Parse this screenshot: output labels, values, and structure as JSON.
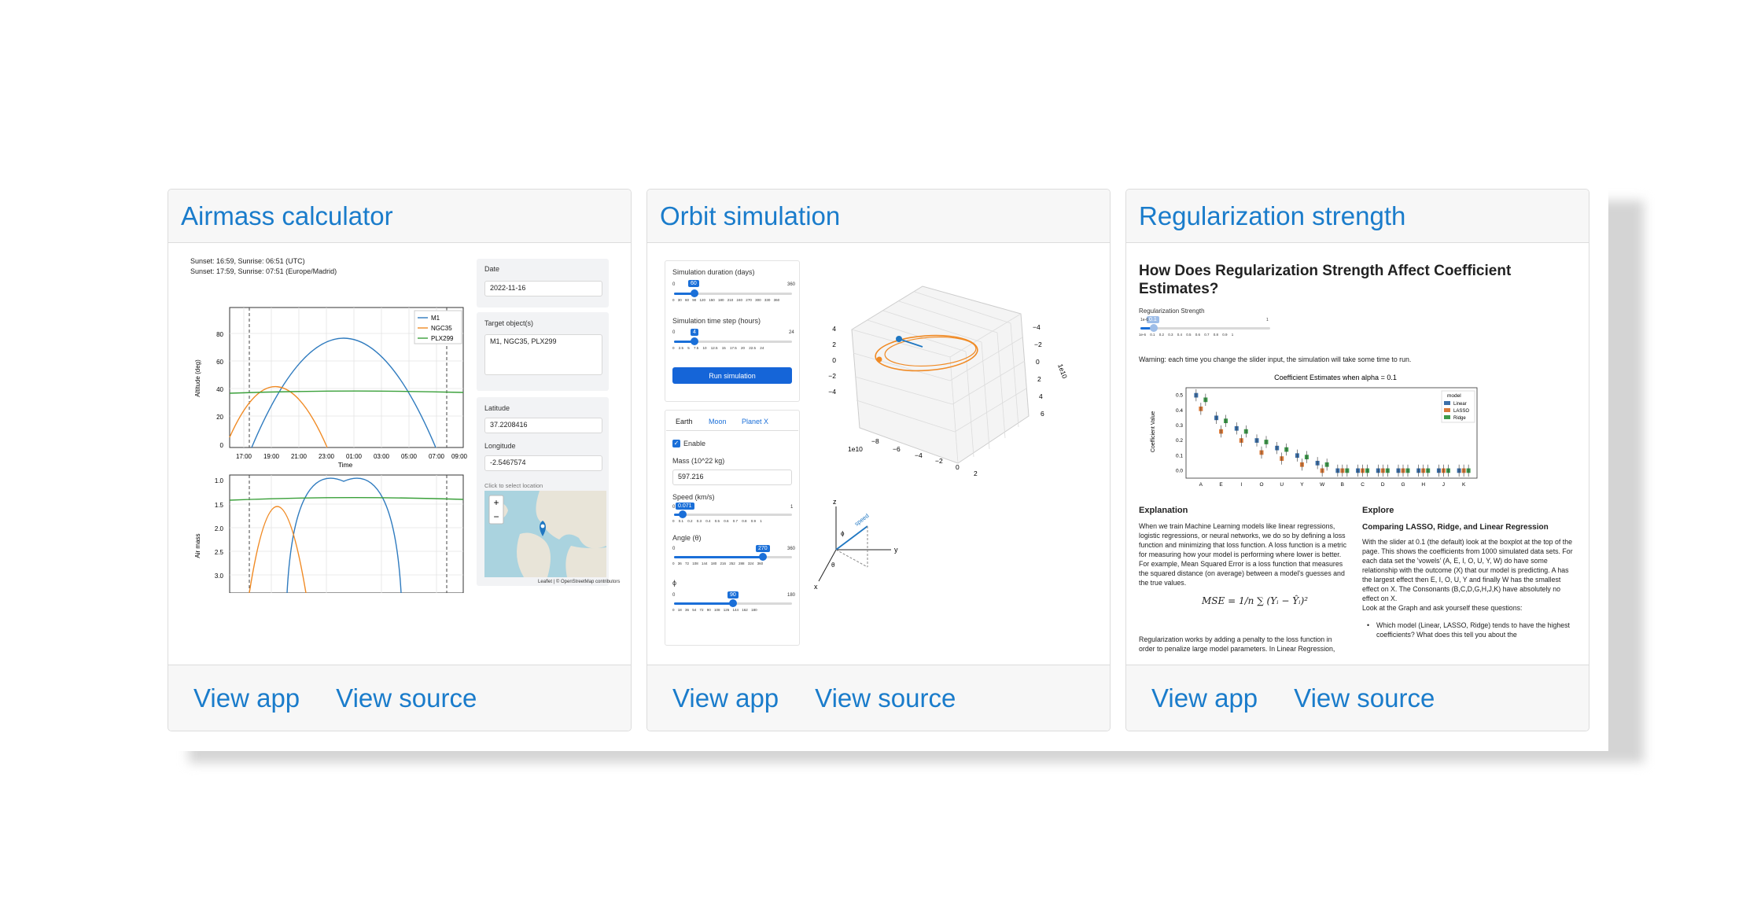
{
  "cards": [
    {
      "title": "Airmass calculator",
      "view_app": "View app",
      "view_source": "View source",
      "sun_line1": "Sunset: 16:59, Sunrise: 06:51 (UTC)",
      "sun_line2": "Sunset: 17:59, Sunrise: 07:51 (Europe/Madrid)",
      "date_label": "Date",
      "date_value": "2022-11-16",
      "target_label": "Target object(s)",
      "target_value": "M1, NGC35, PLX299",
      "lat_label": "Latitude",
      "lat_value": "37.2208416",
      "lon_label": "Longitude",
      "lon_value": "-2.5467574",
      "map_hint": "Click to select location",
      "map_attrib": "Leaflet | © OpenStreetMap contributors",
      "chart_top": {
        "ylabel": "Altitude (deg)",
        "xlabel": "Time",
        "yticks": [
          "0",
          "20",
          "40",
          "60",
          "80"
        ],
        "xticks": [
          "17:00",
          "19:00",
          "21:00",
          "23:00",
          "01:00",
          "03:00",
          "05:00",
          "07:00",
          "09:00"
        ],
        "legend": [
          "M1",
          "NGC35",
          "PLX299"
        ]
      },
      "chart_bottom": {
        "ylabel": "Air mass",
        "yticks": [
          "1.0",
          "1.5",
          "2.0",
          "2.5",
          "3.0"
        ]
      }
    },
    {
      "title": "Orbit simulation",
      "view_app": "View app",
      "view_source": "View source",
      "duration_label": "Simulation duration (days)",
      "duration_value": "60",
      "duration_min": "0",
      "duration_max": "360",
      "duration_ticks": "0 30 60 90 120 150 180 210 240 270 300 330 360",
      "timestep_label": "Simulation time step (hours)",
      "timestep_value": "4",
      "timestep_min": "0",
      "timestep_max": "24",
      "timestep_ticks": "0 2.5 5 7.5 10 12.5 15 17.5 20 22.5 24",
      "run_button": "Run simulation",
      "tabs": [
        "Earth",
        "Moon",
        "Planet X"
      ],
      "enable_label": "Enable",
      "mass_label": "Mass (10^22 kg)",
      "mass_value": "597.216",
      "speed_label": "Speed (km/s)",
      "speed_value": "0.071",
      "speed_min": "0",
      "speed_max": "1",
      "speed_ticks": "0 0.1 0.2 0.3 0.4 0.5 0.6 0.7 0.8 0.9 1",
      "angle_label": "Angle (θ)",
      "angle_value": "270",
      "angle_min": "0",
      "angle_max": "360",
      "angle_ticks": "0 36 72 108 144 180 216 252 288 324 360",
      "phi_label": "ϕ",
      "phi_value": "90",
      "phi_min": "0",
      "phi_max": "180",
      "phi_ticks": "0 18 36 54 72 90 108 126 144 162 180",
      "plot3d": {
        "zticks": [
          "4",
          "2",
          "0",
          "−2",
          "−4"
        ],
        "xticks": [
          "−8",
          "−6",
          "−4",
          "−2",
          "0",
          "2"
        ],
        "yticks": [
          "−4",
          "−2",
          "0",
          "2",
          "4",
          "6"
        ],
        "xexp": "1e10",
        "yexp": "1e10"
      },
      "axes_diagram": {
        "z": "z",
        "y": "y",
        "x": "x",
        "speed": "speed",
        "phi": "ϕ",
        "theta": "θ"
      }
    },
    {
      "title": "Regularization strength",
      "view_app": "View app",
      "view_source": "View source",
      "heading": "How Does Regularization Strength Affect Coefficient Estimates?",
      "slider_label": "Regularization Strength",
      "slider_value": "0.1",
      "slider_min": "1e-6",
      "slider_max": "1",
      "slider_ticks": "1e-6 0.1 0.2 0.3 0.4 0.5 0.6 0.7 0.8 0.9 1",
      "warning": "Warning: each time you change the slider input, the simulation will take some time to run.",
      "chart_title": "Coefficient Estimates when alpha = 0.1",
      "chart_ylabel": "Coefficient Value",
      "legend_title": "model",
      "legend": [
        "Linear",
        "LASSO",
        "Ridge"
      ],
      "explanation_title": "Explanation",
      "explanation_text": "When we train Machine Learning models like linear regressions, logistic regressions, or neural networks, we do so by defining a loss function and minimizing that loss function. A loss function is a metric for measuring how your model is performing where lower is better. For example, Mean Squared Error is a loss function that measures the squared distance (on average) between a model's guesses and the true values.",
      "formula": "MSE = 1/n ∑ (Yᵢ − Ŷᵢ)²",
      "explanation_text2": "Regularization works by adding a penalty to the loss function in order to penalize large model parameters. In Linear Regression,",
      "explore_title": "Explore",
      "compare_title": "Comparing LASSO, Ridge, and Linear Regression",
      "explore_text": "With the slider at 0.1 (the default) look at the boxplot at the top of the page. This shows the coefficients from 1000 simulated data sets. For each data set the 'vowels' (A, E, I, O, U, Y, W) do have some relationship with the outcome (X) that our model is predicting. A has the largest effect then E, I, O, U, Y and finally W has the smallest effect on X. The Consonants (B,C,D,G,H,J,K) have absolutely no effect on X.",
      "explore_text2": "Look at the Graph and ask yourself these questions:",
      "bullet1": "Which model (Linear, LASSO, Ridge) tends to have the highest coefficients? What does this tell you about the"
    }
  ],
  "chart_data": {
    "type": "box",
    "title": "Coefficient Estimates when alpha = 0.1",
    "ylabel": "Coefficient Value",
    "categories": [
      "A",
      "E",
      "I",
      "O",
      "U",
      "Y",
      "W",
      "B",
      "C",
      "D",
      "G",
      "H",
      "J",
      "K"
    ],
    "ylim": [
      -0.05,
      0.55
    ],
    "yticks": [
      "0.0",
      "0.1",
      "0.2",
      "0.3",
      "0.4",
      "0.5"
    ],
    "series": [
      {
        "name": "Linear",
        "color": "#3b6fa8",
        "values": [
          0.5,
          0.35,
          0.28,
          0.2,
          0.15,
          0.1,
          0.05,
          0.0,
          0.0,
          0.0,
          0.0,
          0.0,
          0.0,
          0.0
        ]
      },
      {
        "name": "LASSO",
        "color": "#d97a3a",
        "values": [
          0.41,
          0.26,
          0.2,
          0.12,
          0.08,
          0.04,
          0.0,
          0.0,
          0.0,
          0.0,
          0.0,
          0.0,
          0.0,
          0.0
        ]
      },
      {
        "name": "Ridge",
        "color": "#3d9a4a",
        "values": [
          0.47,
          0.33,
          0.26,
          0.19,
          0.14,
          0.09,
          0.04,
          0.0,
          0.0,
          0.0,
          0.0,
          0.0,
          0.0,
          0.0
        ]
      }
    ]
  }
}
